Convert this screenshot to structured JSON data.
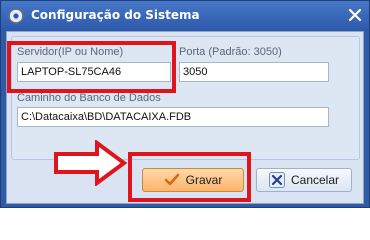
{
  "window": {
    "title": "Configuração do Sistema"
  },
  "form": {
    "server_label": "Servidor(IP ou Nome)",
    "server_value": "LAPTOP-SL75CA46",
    "port_label": "Porta (Padrão: 3050)",
    "port_value": "3050",
    "db_path_label": "Caminho do Banco de Dados",
    "db_path_value": "C:\\Datacaixa\\BD\\DATACAIXA.FDB"
  },
  "buttons": {
    "save_label": "Gravar",
    "cancel_label": "Cancelar"
  },
  "colors": {
    "highlight": "#e0141c",
    "titlebar": "#2f5aa4",
    "save_button": "#fcb46a"
  },
  "icons": {
    "app": "gear-icon",
    "close": "close-x-icon",
    "save": "checkmark-icon",
    "cancel": "cancel-x-icon",
    "annotation": "right-arrow-icon"
  }
}
